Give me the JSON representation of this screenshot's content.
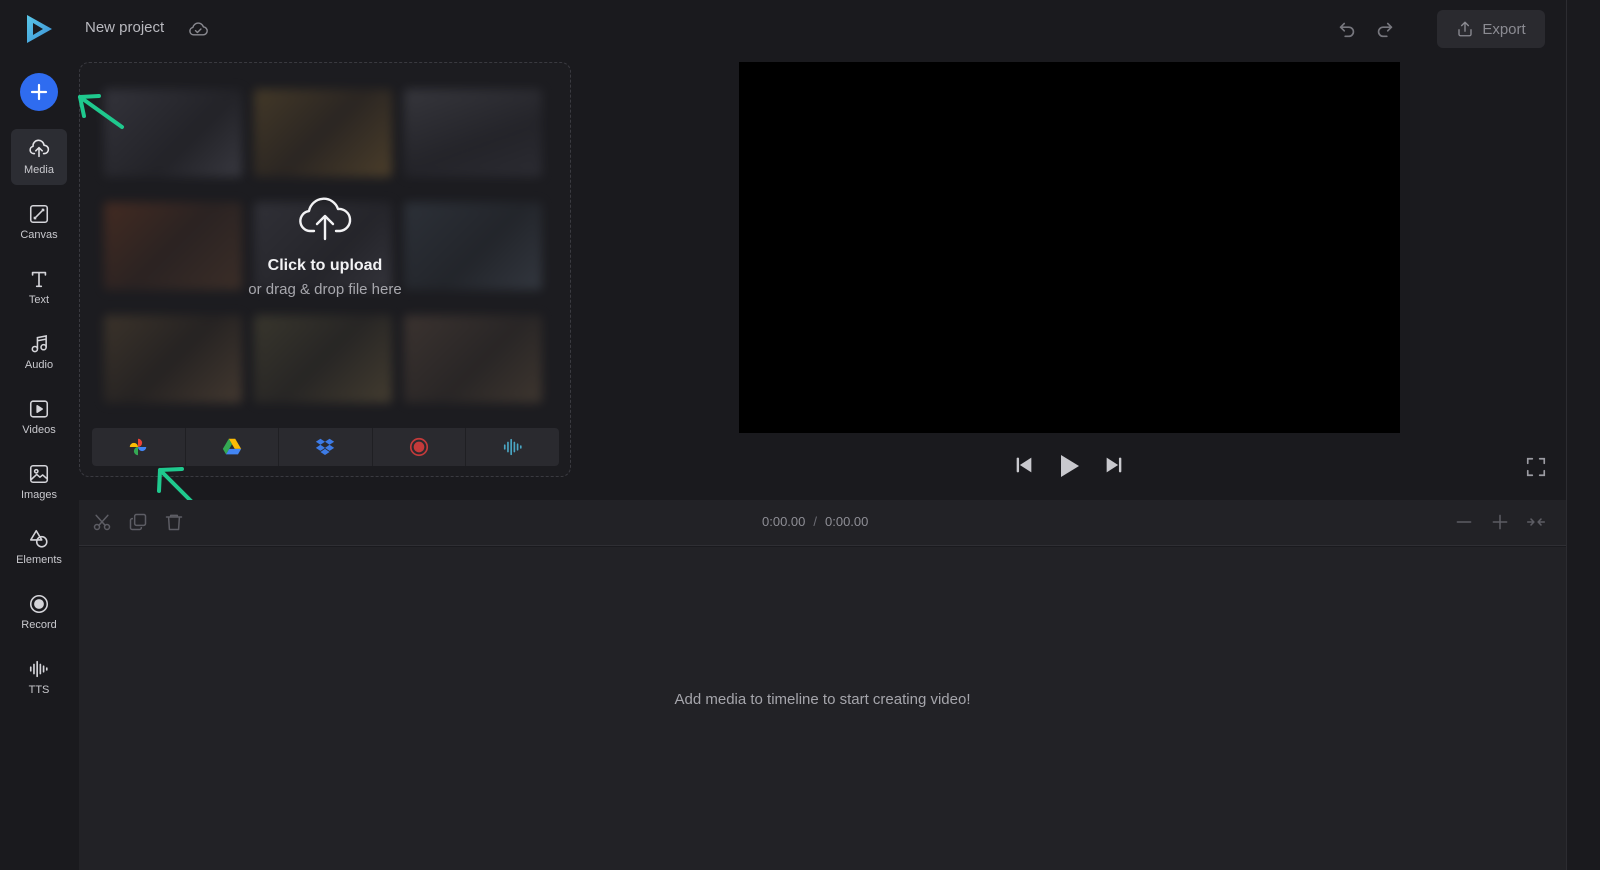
{
  "header": {
    "project_title": "New project",
    "export_label": "Export"
  },
  "sidebar": {
    "items": [
      {
        "label": "Media",
        "icon": "cloud-upload-icon",
        "active": true
      },
      {
        "label": "Canvas",
        "icon": "canvas-icon"
      },
      {
        "label": "Text",
        "icon": "text-icon"
      },
      {
        "label": "Audio",
        "icon": "music-note-icon"
      },
      {
        "label": "Videos",
        "icon": "video-icon"
      },
      {
        "label": "Images",
        "icon": "image-icon"
      },
      {
        "label": "Elements",
        "icon": "shapes-icon"
      },
      {
        "label": "Record",
        "icon": "record-icon"
      },
      {
        "label": "TTS",
        "icon": "waveform-icon"
      }
    ]
  },
  "upload": {
    "title": "Click to upload",
    "subtitle": "or drag & drop file here",
    "sources": [
      "google-photos-icon",
      "google-drive-icon",
      "dropbox-icon",
      "record-icon",
      "waveform-icon"
    ]
  },
  "timeline": {
    "current_time": "0:00.00",
    "separator": "/",
    "total_time": "0:00.00",
    "empty_message": "Add media to timeline to start creating video!"
  },
  "colors": {
    "accent": "#2f6cf0",
    "arrow": "#1fc98e",
    "background": "#1a1a1e",
    "panel": "#222226"
  }
}
